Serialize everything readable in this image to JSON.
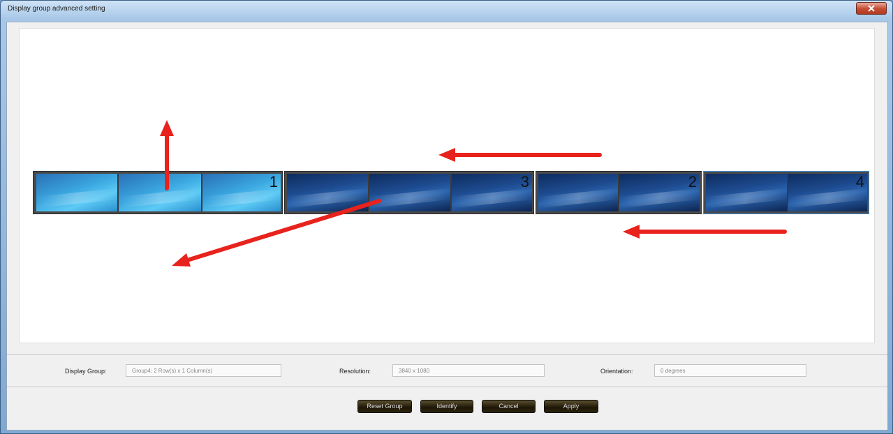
{
  "window": {
    "title": "Display group advanced setting",
    "close_icon": "close-x-icon"
  },
  "monitors": [
    {
      "number": "1",
      "style": "light"
    },
    {
      "number": "3",
      "style": "dark"
    },
    {
      "number": "2",
      "style": "dark"
    },
    {
      "number": "4",
      "style": "dark",
      "selected": true
    }
  ],
  "annotations": {
    "arrow_color": "#e8221c",
    "arrows": [
      "arrow-up",
      "arrow-left-top",
      "arrow-left-bottom",
      "arrow-diagonal-down-left"
    ]
  },
  "fields": {
    "display_group_label": "Display Group:",
    "display_group_value": "Group4: 2 Row(s) x 1 Column(s)",
    "resolution_label": "Resolution:",
    "resolution_value": "3840 x 1080",
    "orientation_label": "Orientation:",
    "orientation_value": "0 degrees"
  },
  "buttons": {
    "reset_group": "Reset Group",
    "identify": "Identify",
    "cancel": "Cancel",
    "apply": "Apply"
  }
}
